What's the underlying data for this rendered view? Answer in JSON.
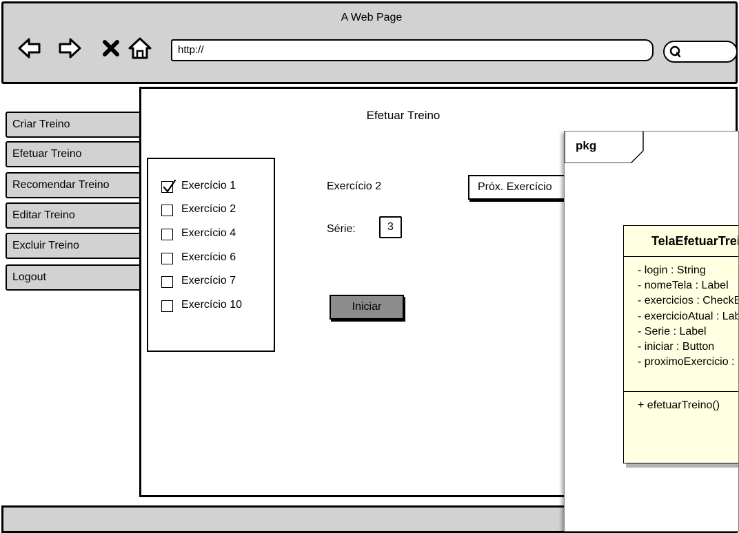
{
  "browser": {
    "window_title": "A Web Page",
    "url": "http://",
    "nav_icons": [
      "back-arrow-icon",
      "forward-arrow-icon",
      "close-x-icon",
      "home-icon"
    ],
    "search_icon": "search-icon"
  },
  "sidebar": {
    "items": [
      {
        "label": "Criar Treino"
      },
      {
        "label": "Efetuar Treino"
      },
      {
        "label": "Recomendar Treino"
      },
      {
        "label": "Editar Treino"
      },
      {
        "label": "Excluir Treino"
      },
      {
        "label": "Logout"
      }
    ]
  },
  "main": {
    "title": "Efetuar Treino",
    "exercises": [
      {
        "label": "Exercício 1",
        "checked": true
      },
      {
        "label": "Exercício 2",
        "checked": false
      },
      {
        "label": "Exercício 4",
        "checked": false
      },
      {
        "label": "Exercício 6",
        "checked": false
      },
      {
        "label": "Exercício 7",
        "checked": false
      },
      {
        "label": "Exercício 10",
        "checked": false
      }
    ],
    "current_exercise": "Exercício 2",
    "serie_label": "Série:",
    "serie_value": "3",
    "next_button": "Próx. Exercício",
    "start_button": "Iniciar"
  },
  "uml": {
    "package_label": "pkg",
    "class_name": "TelaEfetuarTreino",
    "attributes": [
      "- login : String",
      "- nomeTela : Label",
      "- exercicios : CheckBox",
      "- exercicioAtual : Label",
      "- Serie : Label",
      "- iniciar : Button",
      "- proximoExercicio : Button"
    ],
    "methods": [
      "+ efetuarTreino()"
    ]
  },
  "colors": {
    "chrome_gray": "#d2d2d2",
    "button_dark_gray": "#8c8c8c",
    "uml_class_fill": "#ffffe1"
  }
}
